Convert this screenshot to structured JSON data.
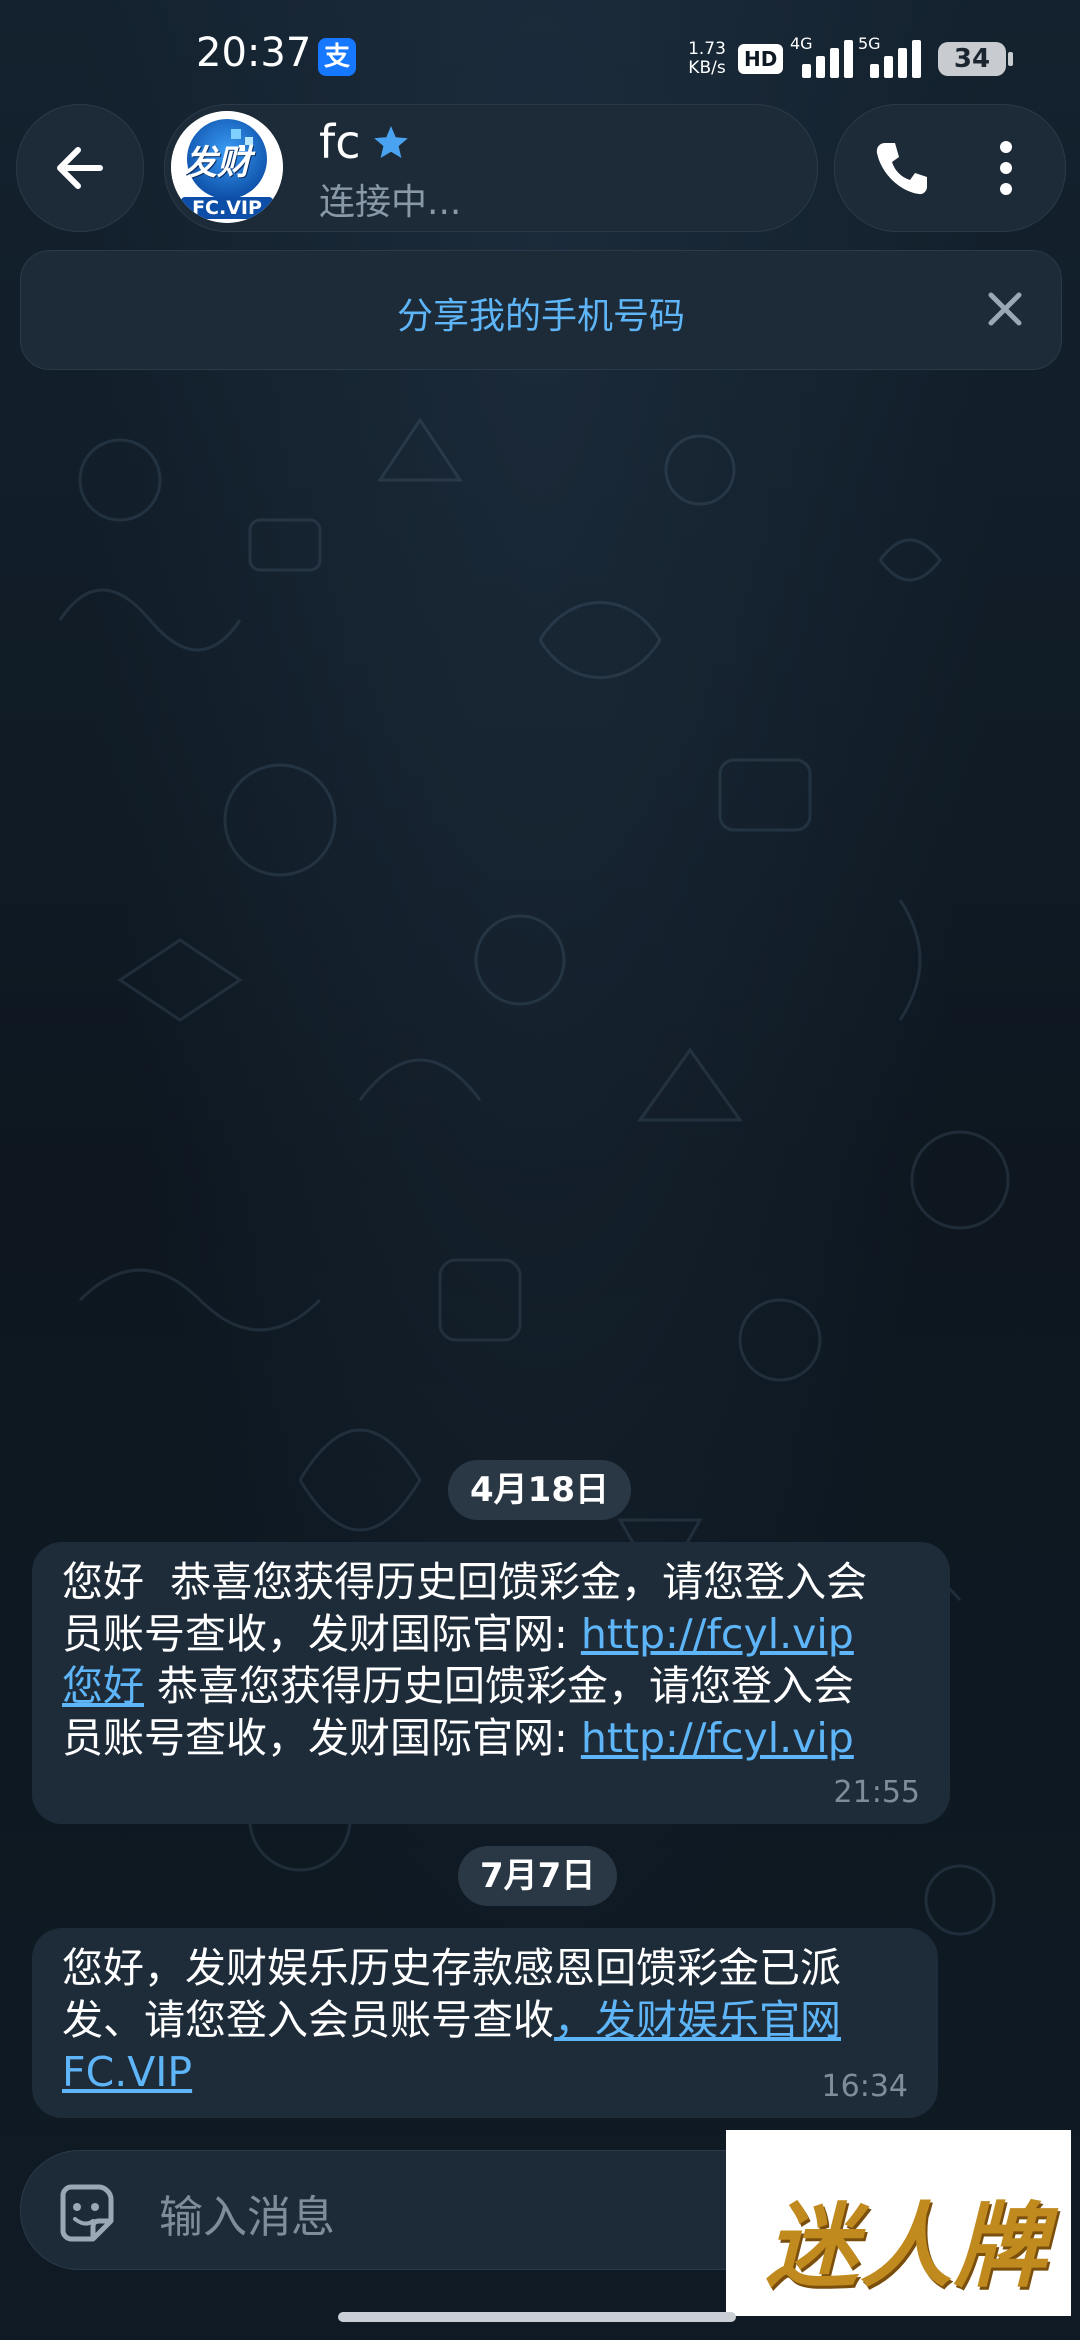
{
  "status_bar": {
    "time": "20:37",
    "alipay_badge": "支",
    "net_speed_value": "1.73",
    "net_speed_unit": "KB/s",
    "hd_label": "HD",
    "sig1_label": "4G",
    "sig2_label": "5G",
    "battery": "34"
  },
  "header": {
    "contact_name": "fc",
    "contact_status": "连接中...",
    "avatar_text_top": "发财",
    "avatar_text_bottom": "FC.VIP"
  },
  "banner": {
    "share_text": "分享我的手机号码"
  },
  "messages": {
    "date1": "4月18日",
    "m1_l1": "您好  恭喜您获得历史回馈彩金，请您登入会",
    "m1_l2_text": "员账号查收，发财国际官网: ",
    "m1_l2_link": "http://fcyl.vip",
    "m1_l3_link": "您好",
    "m1_l3_text": " 恭喜您获得历史回馈彩金，请您登入会",
    "m1_l4_text": "员账号查收，发财国际官网: ",
    "m1_l4_link": "http://fcyl.vip",
    "m1_time": "21:55",
    "date2": "7月7日",
    "m2_l1": "您好，发财娱乐历史存款感恩回馈彩金已派",
    "m2_l2_text": "发、请您登入会员账号查收",
    "m2_l2_link": "，发财娱乐官网",
    "m2_l3_link": "FC.VIP",
    "m2_time": "16:34"
  },
  "input": {
    "placeholder": "输入消息"
  },
  "watermark": {
    "text": "迷人牌"
  },
  "colors": {
    "background": "#0f1923",
    "bubble": "#1e2c3a",
    "link": "#5eb5f7",
    "accent_blue": "#1677ff"
  },
  "icons": [
    "back-arrow-icon",
    "verified-star-icon",
    "phone-icon",
    "more-vertical-icon",
    "close-icon",
    "sticker-icon"
  ]
}
